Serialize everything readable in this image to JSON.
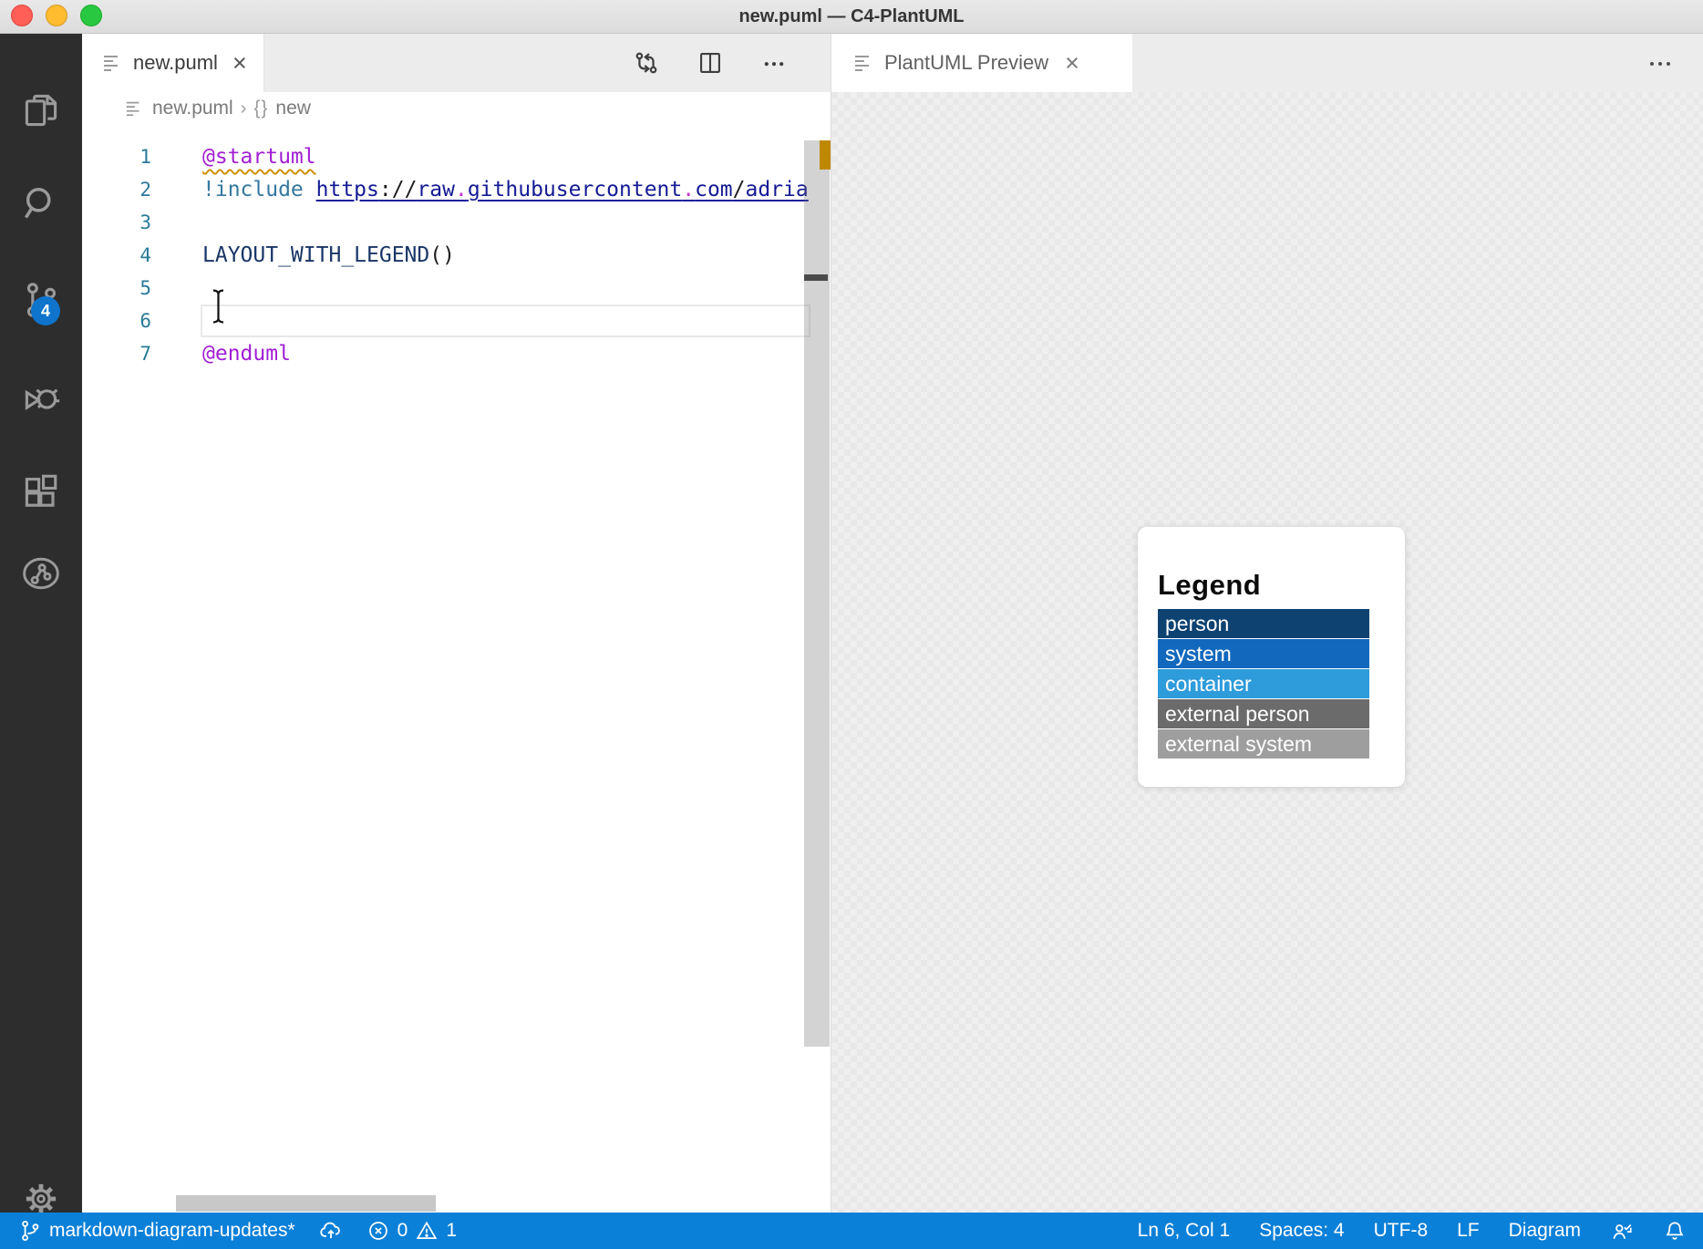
{
  "window": {
    "title": "new.puml — C4-PlantUML"
  },
  "icons": {
    "close": "×"
  },
  "editor_tab": {
    "label": "new.puml"
  },
  "preview_tab": {
    "label": "PlantUML Preview"
  },
  "breadcrumb": {
    "file": "new.puml",
    "sep": "›",
    "symbol_kind": "{}",
    "symbol": "new"
  },
  "code": {
    "line_numbers": [
      "1",
      "2",
      "3",
      "4",
      "5",
      "6",
      "7"
    ],
    "l1": "@startuml",
    "l2_directive": "!include ",
    "url": {
      "p1": "https",
      "p2": "://",
      "p3": "raw",
      "d1": ".",
      "p4": "githubusercontent",
      "d2": ".",
      "p5": "com",
      "p6": "/",
      "p7": "adria"
    },
    "l4_name": "LAYOUT_WITH_LEGEND",
    "l4_paren": "()",
    "l7": "@enduml"
  },
  "legend": {
    "title": "Legend",
    "entries": [
      {
        "label": "person",
        "color": "#0d4271"
      },
      {
        "label": "system",
        "color": "#1168bd"
      },
      {
        "label": "container",
        "color": "#2e9bdb"
      },
      {
        "label": "external person",
        "color": "#6b6b6b"
      },
      {
        "label": "external system",
        "color": "#9e9e9e"
      }
    ]
  },
  "source_control": {
    "badge_count": "4"
  },
  "status_bar": {
    "branch": "markdown-diagram-updates*",
    "errors": "0",
    "warnings": "1",
    "line_col": "Ln 6, Col 1",
    "indent": "Spaces: 4",
    "encoding": "UTF-8",
    "eol": "LF",
    "mode": "Diagram"
  },
  "colors": {
    "status_bar": "#0b80d8",
    "badge": "#0e74cc",
    "traffic_red": "#ff5f57",
    "traffic_yellow": "#febc2e",
    "traffic_green": "#28c840",
    "warning_marker": "#bf8803"
  }
}
